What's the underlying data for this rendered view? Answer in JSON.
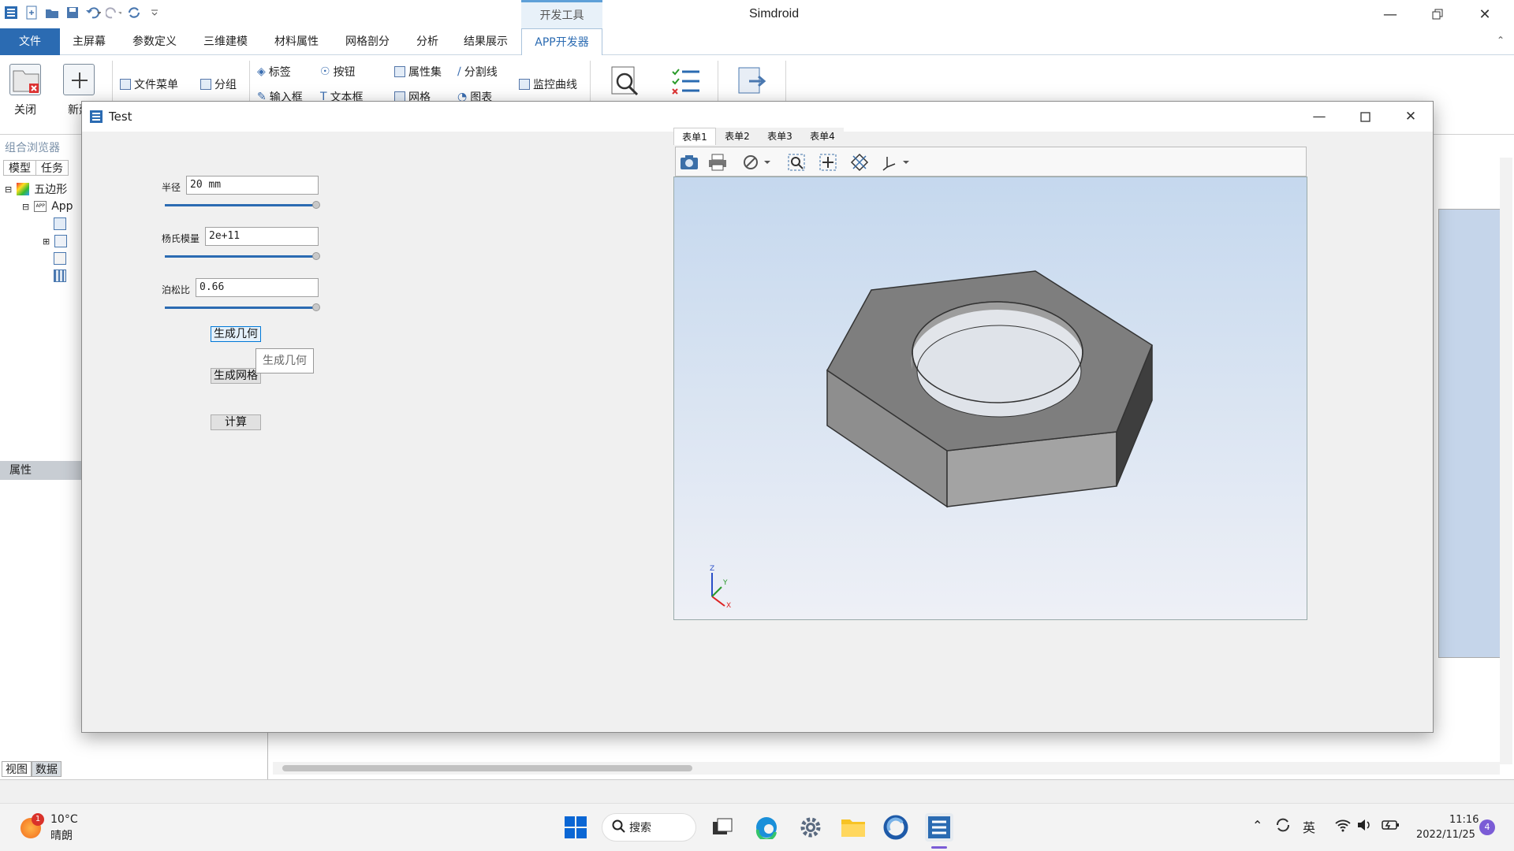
{
  "window": {
    "title": "Simdroid",
    "contextual_tab": "开发工具"
  },
  "menu": {
    "tabs": [
      "文件",
      "主屏幕",
      "参数定义",
      "三维建模",
      "材料属性",
      "网格剖分",
      "分析",
      "结果展示",
      "APP开发器"
    ]
  },
  "ribbon": {
    "close": "关闭",
    "new": "新建",
    "file_menu": "文件菜单",
    "group": "分组",
    "label": "标签",
    "button": "按钮",
    "property_set": "属性集",
    "splitter": "分割线",
    "monitor_curve": "监控曲线",
    "input_box": "输入框",
    "text_box": "文本框",
    "mesh": "网格",
    "chart": "图表"
  },
  "left": {
    "browser_title": "组合浏览器",
    "tabs": [
      "模型",
      "任务"
    ],
    "tree": {
      "root": "五边形",
      "child": "App"
    },
    "properties": "属性",
    "bottom_tabs": [
      "视图",
      "数据"
    ]
  },
  "dialog": {
    "title": "Test",
    "radius_label": "半径",
    "radius_value": "20 mm",
    "youngs_label": "杨氏模量",
    "youngs_value": "2e+11",
    "poisson_label": "泊松比",
    "poisson_value": "0.66",
    "btn_geom": "生成几何",
    "btn_mesh": "生成网格",
    "btn_calc": "计算",
    "tooltip": "生成几何",
    "viewer_tabs": [
      "表单1",
      "表单2",
      "表单3",
      "表单4"
    ],
    "triad": {
      "x": "X",
      "y": "Y",
      "z": "Z"
    }
  },
  "taskbar": {
    "weather_temp": "10°C",
    "weather_desc": "晴朗",
    "weather_badge": "1",
    "search": "搜索",
    "ime": "英",
    "time": "11:16",
    "date": "2022/11/25",
    "notif": "4"
  }
}
